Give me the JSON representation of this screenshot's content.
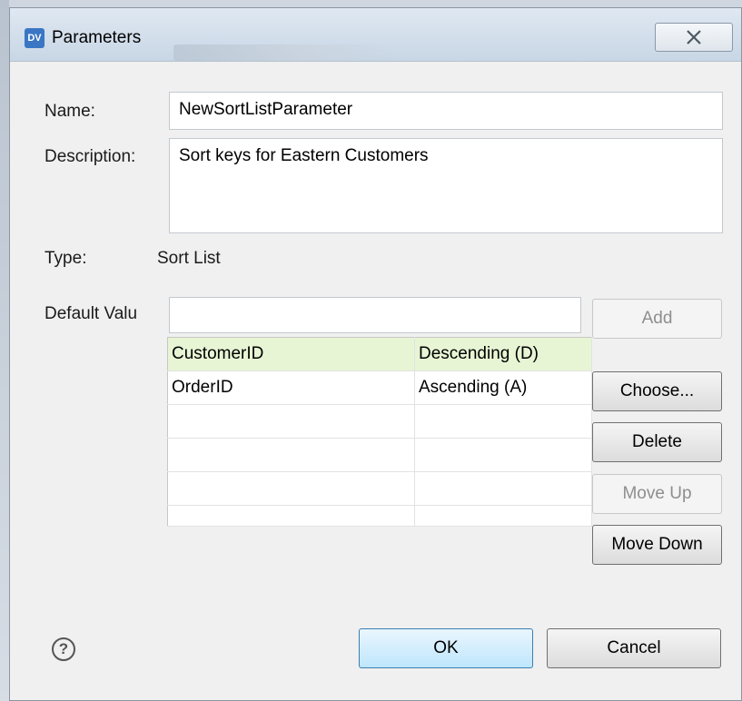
{
  "window": {
    "title": "Parameters",
    "icon_text": "DV",
    "close_icon": "close-x-icon"
  },
  "form": {
    "name_label": "Name:",
    "name_value": "NewSortListParameter",
    "description_label": "Description:",
    "description_value": "Sort keys for Eastern Customers",
    "type_label": "Type:",
    "type_value": "Sort List",
    "default_value_label": "Default Valu",
    "default_value_input": ""
  },
  "sort_keys": {
    "rows": [
      {
        "column": "CustomerID",
        "order": "Descending (D)"
      },
      {
        "column": "OrderID",
        "order": "Ascending (A)"
      },
      {
        "column": "",
        "order": ""
      },
      {
        "column": "",
        "order": ""
      },
      {
        "column": "",
        "order": ""
      },
      {
        "column": "",
        "order": ""
      }
    ],
    "selected_row_color": "#e7f5d4"
  },
  "buttons": {
    "add": "Add",
    "choose": "Choose...",
    "delete": "Delete",
    "move_up": "Move Up",
    "move_down": "Move Down",
    "ok": "OK",
    "cancel": "Cancel"
  },
  "help_icon": "question-circle-icon"
}
